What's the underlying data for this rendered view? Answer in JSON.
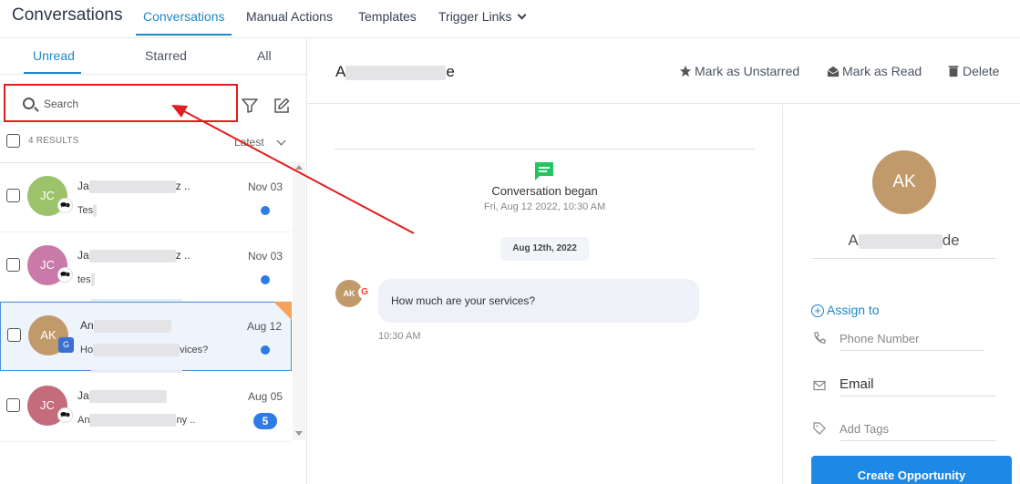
{
  "header": {
    "app_title": "Conversations",
    "tabs": [
      {
        "label": "Conversations",
        "active": true
      },
      {
        "label": "Manual Actions",
        "active": false
      },
      {
        "label": "Templates",
        "active": false
      },
      {
        "label": "Trigger Links",
        "active": false
      }
    ]
  },
  "left_panel": {
    "subtabs": [
      {
        "label": "Unread",
        "active": true
      },
      {
        "label": "Starred",
        "active": false
      },
      {
        "label": "All",
        "active": false
      }
    ],
    "search": {
      "placeholder": "Search",
      "value": ""
    },
    "results_count": "4 RESULTS",
    "sort_label": "Latest",
    "conversations": [
      {
        "initials": "JC",
        "avatar_color": "#9cc26a",
        "channel": "chat-icon",
        "name_start": "Ja",
        "name_end": "z ..",
        "preview_start": "Tes",
        "preview_end": "",
        "date": "Nov 03",
        "unread": "dot"
      },
      {
        "initials": "JC",
        "avatar_color": "#c97aa8",
        "channel": "chat-icon",
        "name_start": "Ja",
        "name_end": "z ..",
        "preview_start": "tes",
        "preview_end": "",
        "date": "Nov 03",
        "unread": "dot"
      },
      {
        "initials": "AK",
        "avatar_color": "#c19a6b",
        "channel": "google-business-icon",
        "name_start": "An",
        "name_end": "",
        "preview_start": "Ho",
        "preview_end": "vices?",
        "date": "Aug 12",
        "unread": "dot",
        "selected": true
      },
      {
        "initials": "JC",
        "avatar_color": "#c46b7c",
        "channel": "chat-icon",
        "name_start": "Ja",
        "name_end": "",
        "preview_start": "An",
        "preview_end": "ny ..",
        "date": "Aug 05",
        "unread": "count",
        "count": "5"
      }
    ]
  },
  "conversation": {
    "contact_name_start": "A",
    "contact_name_end": "e",
    "actions": {
      "unstar": "Mark as Unstarred",
      "read": "Mark as Read",
      "delete": "Delete"
    },
    "began_title": "Conversation began",
    "began_time": "Fri, Aug 12 2022, 10:30 AM",
    "date_chip": "Aug 12th, 2022",
    "messages": [
      {
        "avatar": "AK",
        "text": "How much are your services?",
        "time": "10:30 AM"
      }
    ]
  },
  "contact_panel": {
    "initials": "AK",
    "name_start": "A",
    "name_end": "de",
    "assign_label": "Assign to",
    "phone_placeholder": "Phone Number",
    "email_value": "Email",
    "tags_placeholder": "Add Tags",
    "create_button": "Create Opportunity"
  },
  "colors": {
    "accent": "#1e88c8",
    "annotation_red": "#e11d1d",
    "unread_blue": "#2f7be6"
  }
}
